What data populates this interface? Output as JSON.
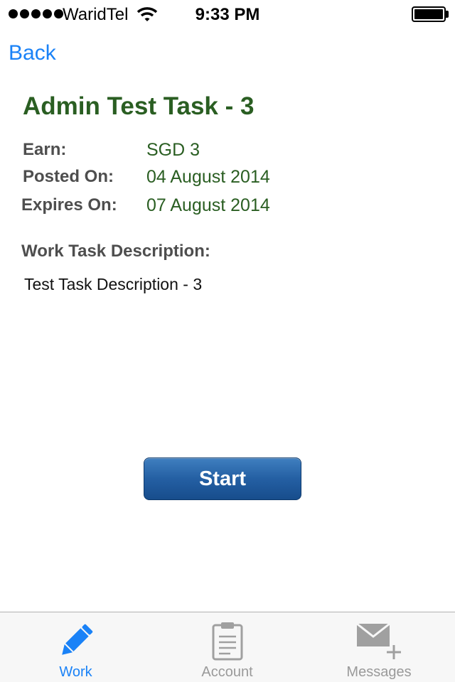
{
  "status_bar": {
    "carrier": "WaridTel",
    "time": "9:33 PM",
    "signal_bars": 5,
    "battery_level": 1.0
  },
  "nav": {
    "back_label": "Back"
  },
  "task": {
    "title": "Admin Test Task - 3",
    "earn_label": "Earn:",
    "earn_value": "SGD 3",
    "posted_label": "Posted On:",
    "posted_value": "04 August 2014",
    "expires_label": "Expires On:",
    "expires_value": "07 August 2014",
    "description_heading": "Work Task Description:",
    "description": "Test Task Description - 3"
  },
  "actions": {
    "start_label": "Start"
  },
  "tab_bar": {
    "selected": "Work",
    "tabs": [
      {
        "label": "Work",
        "icon": "pencil-icon"
      },
      {
        "label": "Account",
        "icon": "clipboard-icon"
      },
      {
        "label": "Messages",
        "icon": "envelope-plus-icon"
      }
    ]
  },
  "colors": {
    "accent": "#1a82f7",
    "title_green": "#2a5e22",
    "label_gray": "#4e4e4e",
    "button_blue": "#245fa3",
    "inactive_tab": "#9a9a9a"
  }
}
